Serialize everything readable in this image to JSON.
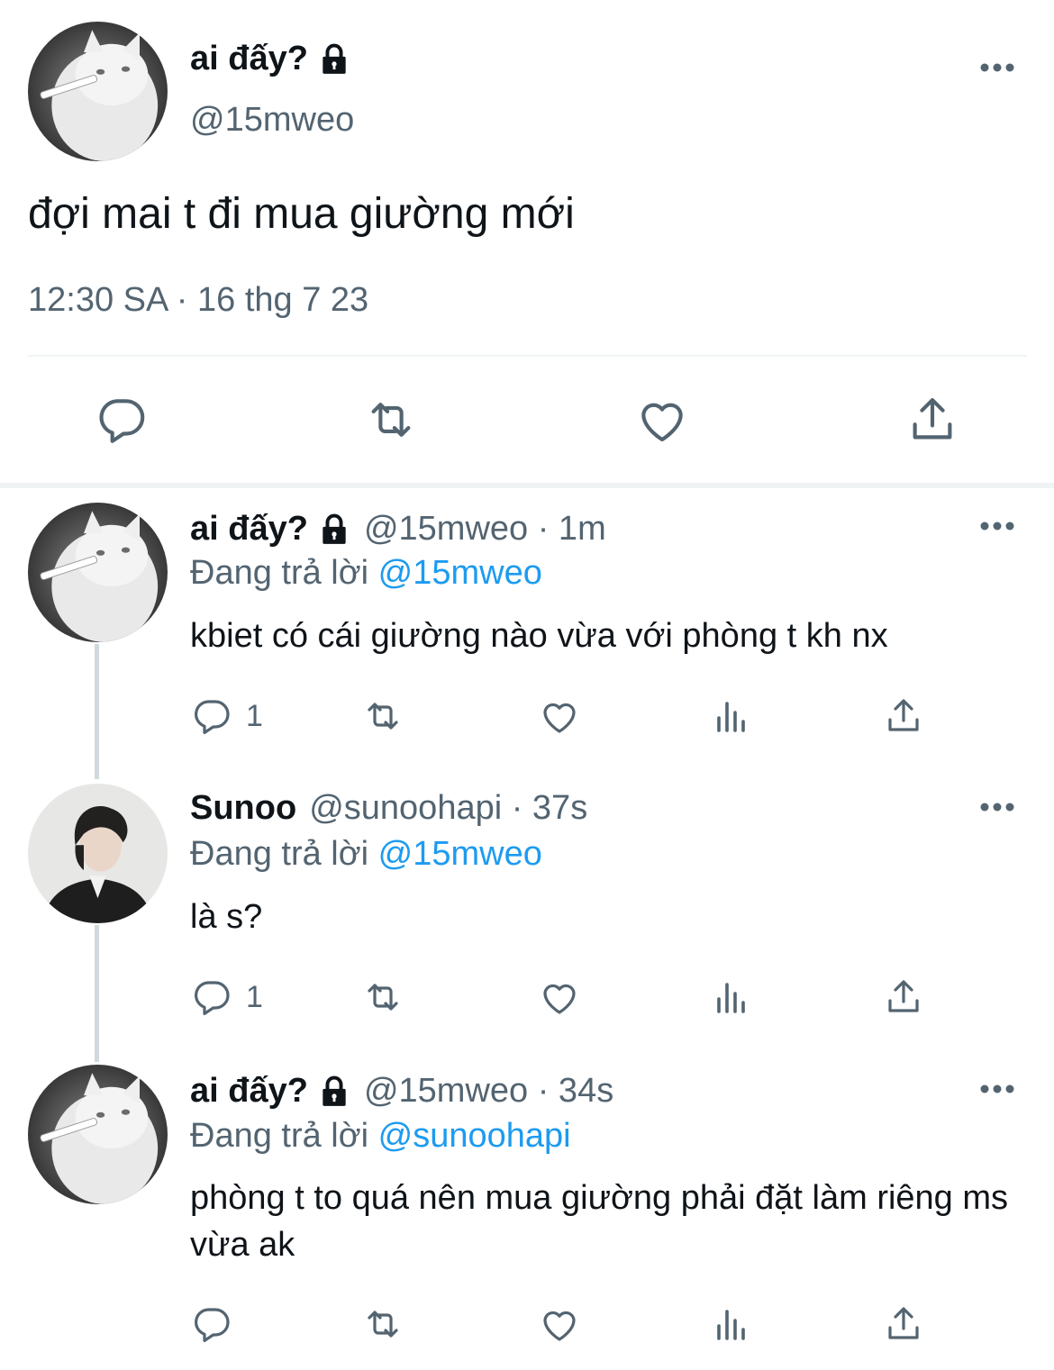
{
  "colors": {
    "text": "#0f1419",
    "secondary": "#536471",
    "accent": "#1d9bf0",
    "divider": "#eff3f4",
    "thread_line": "#cfd9de"
  },
  "main_tweet": {
    "author_name": "ai đấy?",
    "author_handle": "@15mweo",
    "protected_icon": "lock-icon",
    "text": "đợi mai t đi mua giường mới",
    "timestamp": "12:30 SA · 16 thg 7 23",
    "actions": [
      "reply-icon",
      "retweet-icon",
      "like-icon",
      "share-icon"
    ]
  },
  "replies": [
    {
      "author_name": "ai đấy?",
      "protected": true,
      "meta": "@15mweo · 1m",
      "replying_label": "Đang trả lời",
      "replying_to": "@15mweo",
      "text": "kbiet có cái giường nào vừa với phòng t kh nx",
      "reply_count": "1",
      "avatar": "cat-avatar"
    },
    {
      "author_name": "Sunoo",
      "protected": false,
      "meta": "@sunoohapi · 37s",
      "replying_label": "Đang trả lời",
      "replying_to": "@15mweo",
      "text": "là s?",
      "reply_count": "1",
      "avatar": "person-avatar"
    },
    {
      "author_name": "ai đấy?",
      "protected": true,
      "meta": "@15mweo · 34s",
      "replying_label": "Đang trả lời",
      "replying_to": "@sunoohapi",
      "text": "phòng t to quá nên mua giường phải đặt làm riêng ms vừa ak",
      "reply_count": "",
      "avatar": "cat-avatar"
    }
  ]
}
